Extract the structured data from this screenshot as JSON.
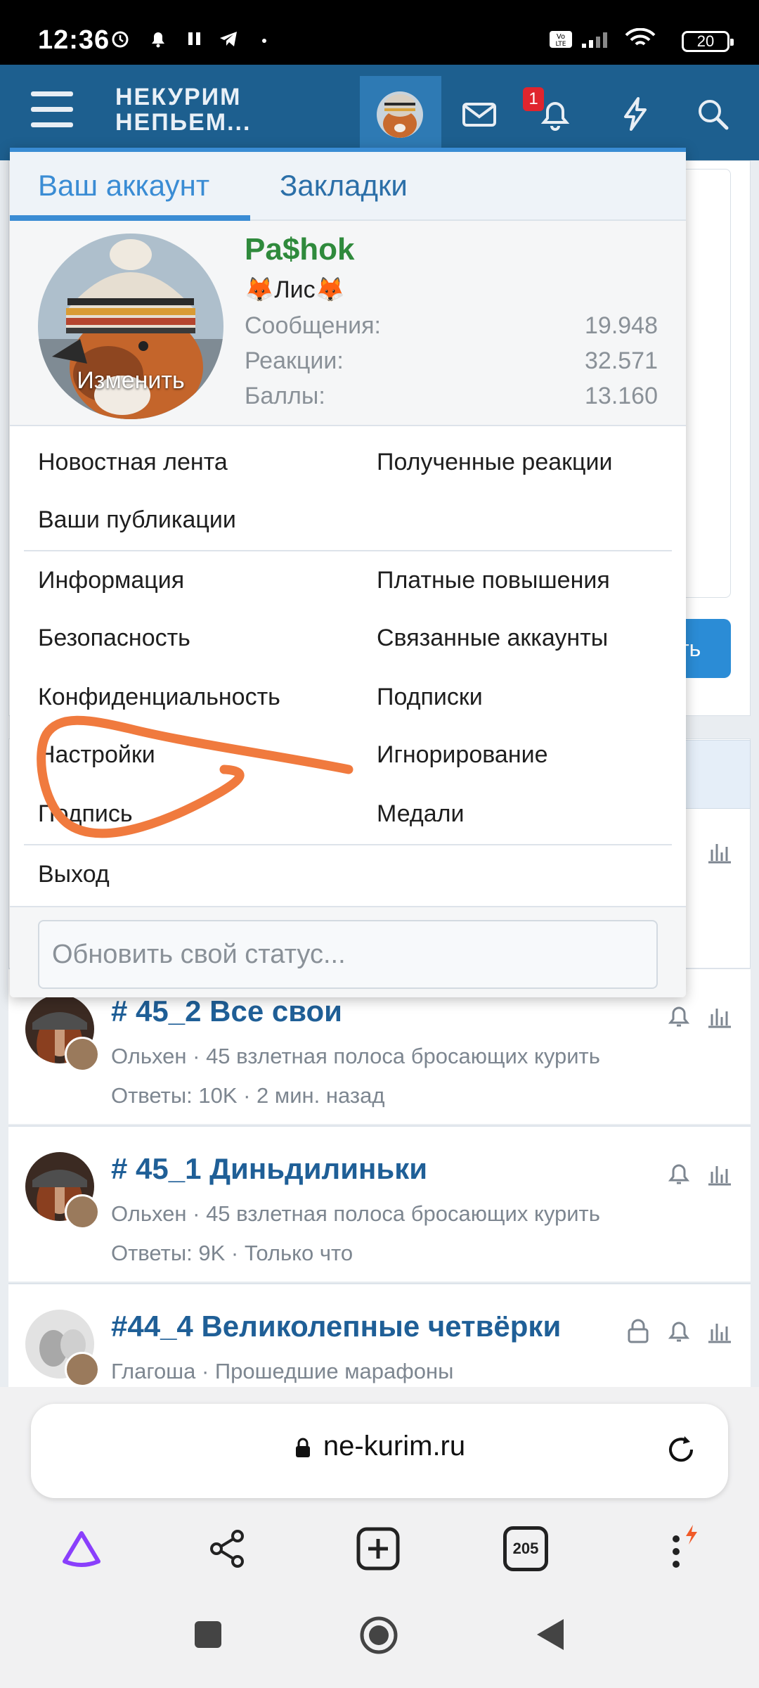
{
  "status_bar": {
    "time": "12:36",
    "battery": "20"
  },
  "header": {
    "logo_line1": "НЕКУРИМ",
    "logo_line2": "НЕПЬЕМ...",
    "alerts_badge": "1"
  },
  "menu": {
    "tabs": [
      {
        "label": "Ваш аккаунт",
        "active": true
      },
      {
        "label": "Закладки",
        "active": false
      }
    ],
    "profile": {
      "avatar_change": "Изменить",
      "username": "Pa$hok",
      "user_title": "🦊Лис🦊",
      "stats": [
        {
          "label": "Сообщения:",
          "value": "19.948"
        },
        {
          "label": "Реакции:",
          "value": "32.571"
        },
        {
          "label": "Баллы:",
          "value": "13.160"
        }
      ]
    },
    "group1": {
      "news_feed": "Новостная лента",
      "reactions_received": "Полученные реакции",
      "your_posts": "Ваши публикации"
    },
    "group2": {
      "information": "Информация",
      "paid_upgrades": "Платные повышения",
      "security": "Безопасность",
      "connected_accounts": "Связанные аккаунты",
      "privacy": "Конфиденциальность",
      "following": "Подписки",
      "preferences": "Настройки",
      "ignoring": "Игнорирование",
      "signature": "Подпись",
      "medals": "Медали"
    },
    "logout": "Выход",
    "status_placeholder": "Обновить свой статус..."
  },
  "background": {
    "button_fragment": "ть"
  },
  "threads": [
    {
      "title": "# 45_2 Все свои",
      "meta": "Ольхен · 45 взлетная полоса бросающих курить",
      "stats": "Ответы: 10K · 2 мин. назад",
      "locked": false
    },
    {
      "title": "# 45_1 Диньдилиньки",
      "meta": "Ольхен · 45 взлетная полоса бросающих курить",
      "stats": "Ответы: 9K · Только что",
      "locked": false
    },
    {
      "title": "#44_4 Великолепные четвёрки",
      "meta": "Глагоша · Прошедшие марафоны",
      "stats": "",
      "locked": true
    }
  ],
  "browser": {
    "url": "ne-kurim.ru",
    "tabs_count": "205"
  },
  "colors": {
    "header": "#1d5f8f",
    "accent": "#3a8cd4",
    "username": "#2f8a3c",
    "annotation": "#f07a3e"
  }
}
